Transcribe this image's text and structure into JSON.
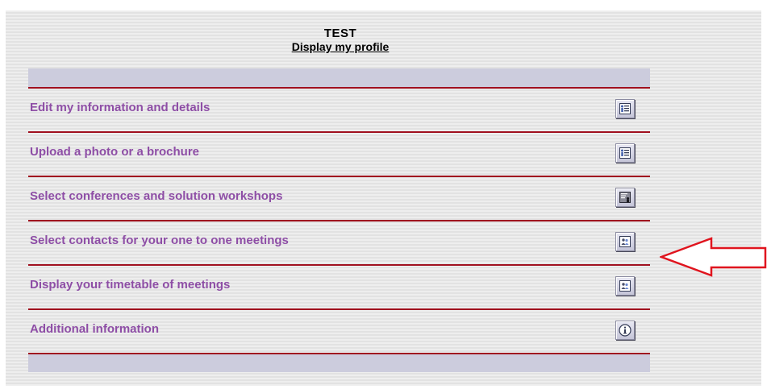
{
  "header": {
    "title": "TEST",
    "profile_link": "Display my profile"
  },
  "menu": {
    "items": [
      {
        "label": "Edit my information and details",
        "icon": "profile-card-icon"
      },
      {
        "label": "Upload a photo or a brochure",
        "icon": "profile-card-icon"
      },
      {
        "label": "Select conferences and solution workshops",
        "icon": "presentation-icon"
      },
      {
        "label": "Select contacts for your one to one meetings",
        "icon": "people-icon"
      },
      {
        "label": "Display your timetable of meetings",
        "icon": "people-icon"
      },
      {
        "label": "Additional information",
        "icon": "info-icon"
      }
    ]
  },
  "colors": {
    "label": "#8e4ea6",
    "separator": "#a0101f",
    "band": "#ccccdd",
    "annotation_arrow": "#e0141e"
  },
  "annotation": {
    "icon": "red-arrow-icon"
  }
}
